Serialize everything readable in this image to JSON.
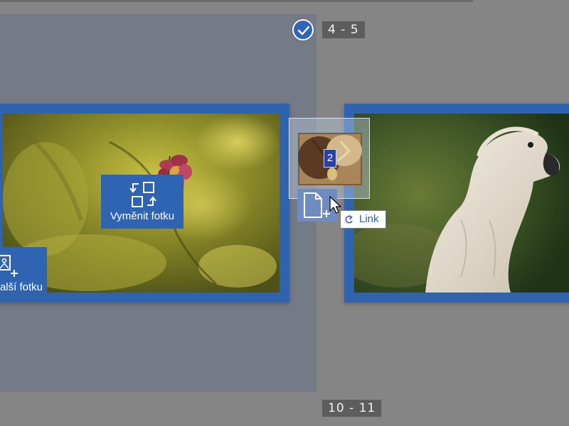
{
  "page_labels": {
    "top": "4 - 5",
    "bottom": "10 - 11"
  },
  "tiles": {
    "swap_label": "Vyměnit fotku",
    "add_label": "alší fotku"
  },
  "drag": {
    "count": "2",
    "tooltip_label": "Link"
  },
  "icons": {
    "selected": "checkmark-icon",
    "swap": "swap-photo-icon",
    "add": "add-photo-icon",
    "insert": "insert-page-icon",
    "cursor": "arrow-cursor-icon",
    "link": "link-icon"
  },
  "colors": {
    "accent": "#2f63ad",
    "background": "#858585",
    "selected_spread": "#747b86",
    "label_bg": "#5d5d5d",
    "drag_count_bg": "#2a3fa8"
  }
}
